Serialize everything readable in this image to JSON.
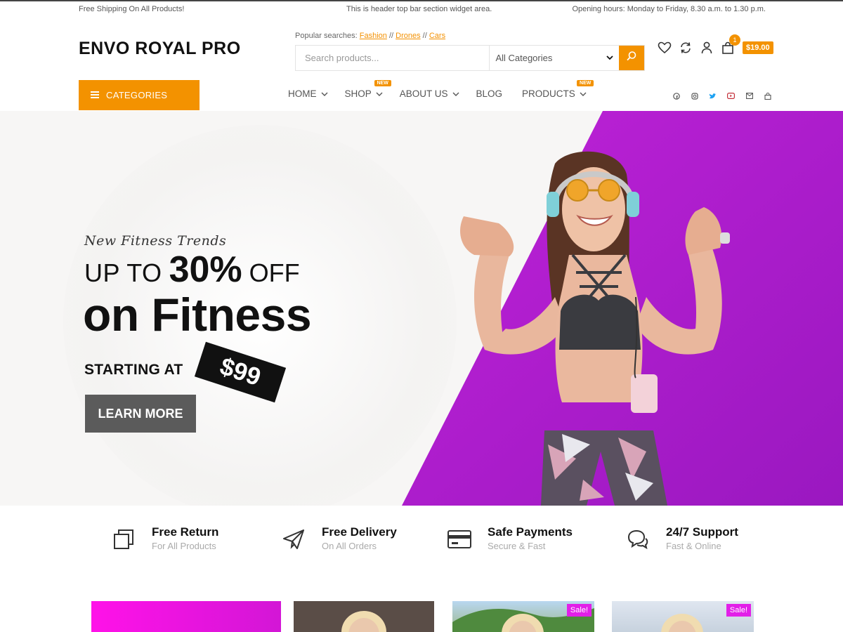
{
  "topbar": {
    "left": "Free Shipping On All Products!",
    "center": "This is header top bar section widget area.",
    "right": "Opening hours: Monday to Friday, 8.30 a.m. to 1.30 p.m."
  },
  "header": {
    "logo": "ENVO ROYAL PRO",
    "popular_label": "Popular searches:",
    "popular_links": [
      "Fashion",
      "Drones",
      "Cars"
    ],
    "popular_sep": "//",
    "search_placeholder": "Search products...",
    "category_select": "All Categories",
    "cart_count": "1",
    "cart_price": "$19.00",
    "icons": [
      "heart-icon",
      "compare-icon",
      "user-icon",
      "cart-icon"
    ]
  },
  "nav": {
    "categories_label": "CATEGORIES",
    "items": [
      {
        "label": "HOME",
        "badge": ""
      },
      {
        "label": "SHOP",
        "badge": "NEW"
      },
      {
        "label": "ABOUT US",
        "badge": ""
      },
      {
        "label": "BLOG",
        "badge": ""
      },
      {
        "label": "PRODUCTS",
        "badge": "NEW"
      }
    ],
    "socials": [
      "facebook-icon",
      "instagram-icon",
      "twitter-icon",
      "youtube-icon",
      "mail-icon",
      "shop-icon"
    ]
  },
  "hero": {
    "subtitle": "New Fitness Trends",
    "line1_a": "UP TO",
    "line1_b": "30%",
    "line1_c": "OFF",
    "line2": "on Fitness",
    "starting": "STARTING AT",
    "price": "$99",
    "button": "LEARN MORE"
  },
  "features": [
    {
      "title": "Free Return",
      "sub": "For All Products",
      "icon": "copy-icon"
    },
    {
      "title": "Free Delivery",
      "sub": "On All Orders",
      "icon": "paper-plane-icon"
    },
    {
      "title": "Safe Payments",
      "sub": "Secure & Fast",
      "icon": "credit-card-icon"
    },
    {
      "title": "24/7 Support",
      "sub": "Fast & Online",
      "icon": "chat-icon"
    }
  ],
  "products": {
    "sale_label": "Sale!"
  },
  "colors": {
    "accent": "#f39200",
    "hero_purple": "#b81fd0",
    "sale_badge": "#e21fe8"
  }
}
